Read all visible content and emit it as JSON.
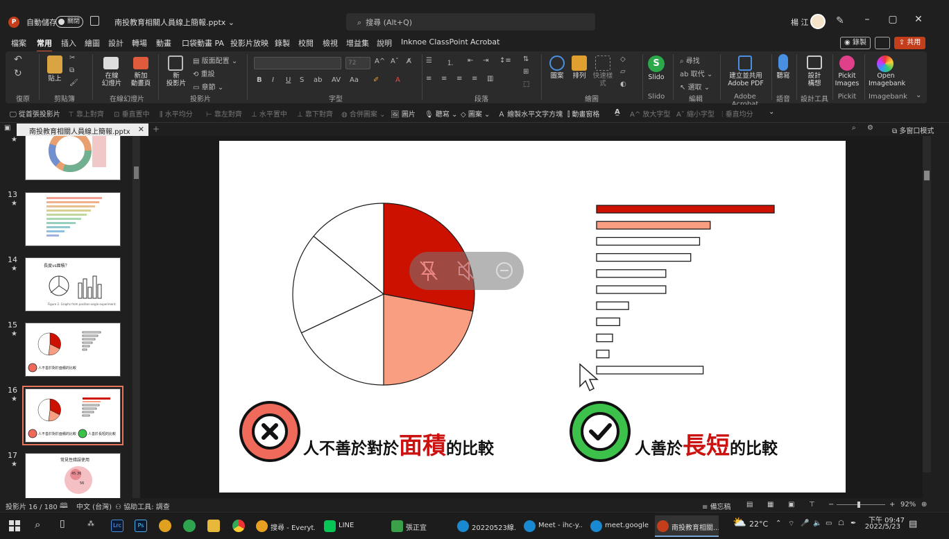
{
  "titlebar": {
    "autosave_label": "自動儲存",
    "autosave_state": "關閉",
    "file_name": "南投教育相關人員線上簡報.pptx",
    "file_dropdown": "⌄",
    "search_placeholder": "搜尋 (Alt+Q)",
    "user_name": "楊 江"
  },
  "menu": {
    "items": [
      "檔案",
      "常用",
      "插入",
      "繪圖",
      "設計",
      "轉場",
      "動畫",
      "口袋動畫 PA",
      "投影片放映",
      "錄製",
      "校閱",
      "檢視",
      "增益集",
      "說明",
      "Inknoe ClassPoint",
      "Acrobat"
    ],
    "active": "常用",
    "record_label": "錄製",
    "share_label": "共用"
  },
  "ribbon": {
    "groups": [
      "復原",
      "剪貼簿",
      "在線幻燈片",
      "投影片",
      "字型",
      "段落",
      "繪圖",
      "編輯",
      "Adobe Acrobat",
      "語音",
      "設計工具",
      "Pickit",
      "Imagebank"
    ],
    "buttons": {
      "paste": "貼上",
      "online_slide": "在線\n幻燈片",
      "new_animation": "新加\n動畫頁",
      "new_slide": "新\n投影片",
      "layout": "版面配置",
      "reset": "重設",
      "section": "章節",
      "font_size": "72",
      "shapes": "圖案",
      "arrange": "排列",
      "quick_styles": "快速樣式",
      "slido": "Slido",
      "find": "尋找",
      "replace": "取代",
      "select": "選取",
      "adobe_pdf": "建立並共用\nAdobe PDF",
      "dictate": "聽寫",
      "designer": "設計\n構想",
      "pickit": "Pickit\nImages",
      "imagebank": "Open\nImagebank"
    }
  },
  "qat": {
    "items": [
      "從首張投影片",
      "靠上對齊",
      "垂直置中",
      "水平均分",
      "靠左對齊",
      "水平置中",
      "靠下對齊",
      "合併圖案",
      "圖片",
      "聽寫",
      "圖案",
      "繪製水平文字方塊",
      "動畫窗格",
      "放大字型",
      "縮小字型",
      "垂直均分"
    ]
  },
  "doc_tab": {
    "title": "南投教育相關人員線上簡報.pptx",
    "multi_window": "多窗口模式"
  },
  "thumbnails": [
    {
      "num": "13",
      "star": "★"
    },
    {
      "num": "14",
      "star": "★",
      "title": "長度vs面積？",
      "caption": "Figure 2. Graphs from position-angle experiment."
    },
    {
      "num": "15",
      "star": "★",
      "caption": "人不善於對於面積的比較"
    },
    {
      "num": "16",
      "star": "★",
      "caption_left": "人不善於對於面積的比較",
      "caption_right": "人善於長短的比較"
    },
    {
      "num": "17",
      "star": "★",
      "title": "常見性錯誤使用",
      "badges": [
        "45.36",
        "56"
      ]
    }
  ],
  "slide": {
    "left_caption": {
      "prefix": "人不善於對於",
      "highlight": "面積",
      "suffix": "的比較"
    },
    "right_caption": {
      "prefix": "人善於",
      "highlight": "長短",
      "suffix": "的比較"
    },
    "icons": {
      "wrong": "x-circle-icon",
      "right": "check-circle-icon"
    },
    "colors": {
      "red": "#cc1100",
      "salmon": "#fa9e82",
      "white": "#ffffff",
      "wrong_bg": "#f06a5c",
      "right_bg": "#3cc24a"
    }
  },
  "chart_data": [
    {
      "type": "pie",
      "values": [
        28,
        22,
        18,
        18,
        14
      ],
      "colors": [
        "#cc1100",
        "#fa9e82",
        "#ffffff",
        "#ffffff",
        "#ffffff"
      ],
      "title": ""
    },
    {
      "type": "bar",
      "orientation": "horizontal",
      "categories": [
        "",
        "",
        "",
        "",
        "",
        "",
        "",
        "",
        "",
        "",
        ""
      ],
      "values": [
        100,
        64,
        58,
        53,
        39,
        39,
        18,
        13,
        9,
        7,
        60
      ],
      "colors": [
        "#cc1100",
        "#fa9e82",
        "#ffffff",
        "#ffffff",
        "#ffffff",
        "#ffffff",
        "#ffffff",
        "#ffffff",
        "#ffffff",
        "#ffffff",
        "#ffffff"
      ],
      "title": ""
    }
  ],
  "statusbar": {
    "slide_count": "投影片 16 / 180",
    "language": "中文 (台灣)",
    "accessibility": "協助工具: 調查",
    "notes": "備忘稿",
    "zoom": "92%"
  },
  "taskbar": {
    "apps": [
      "搜尋 - Everyt...",
      "LINE",
      "張正宜",
      "20220523線...",
      "Meet - ihc-y...",
      "meet.google...",
      "南投教育相關..."
    ],
    "weather": "22°C",
    "time": "下午 09:47",
    "date": "2022/5/23"
  }
}
